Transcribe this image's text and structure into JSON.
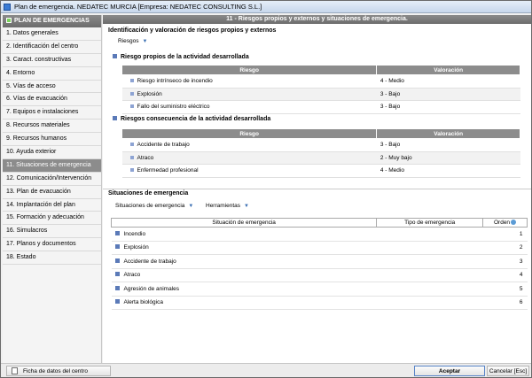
{
  "window": {
    "title": "Plan de emergencia. NEDATEC MURCIA  [Empresa: NEDATEC CONSULTING S.L.]"
  },
  "sidebar": {
    "header": "PLAN DE EMERGENCIAS",
    "items": [
      {
        "label": "1. Datos generales"
      },
      {
        "label": "2. Identificación del centro"
      },
      {
        "label": "3. Caract. constructivas"
      },
      {
        "label": "4. Entorno"
      },
      {
        "label": "5. Vías de acceso"
      },
      {
        "label": "6. Vías de evacuación"
      },
      {
        "label": "7. Equipos e instalaciones"
      },
      {
        "label": "8. Recursos materiales"
      },
      {
        "label": "9. Recursos humanos"
      },
      {
        "label": "10. Ayuda exterior"
      },
      {
        "label": "11. Situaciones de emergencia"
      },
      {
        "label": "12. Comunicación/Intervención"
      },
      {
        "label": "13. Plan de evacuación"
      },
      {
        "label": "14. Implantación del plan"
      },
      {
        "label": "15. Formación y adecuación"
      },
      {
        "label": "16. Simulacros"
      },
      {
        "label": "17. Planos y documentos"
      },
      {
        "label": "18. Estado"
      }
    ],
    "active_index": 10
  },
  "main": {
    "header": "11 - Riesgos propios y externos y situaciones de emergencia.",
    "section1_title": "Identificación y valoración de riesgos propios y externos",
    "riesgos_menu": "Riesgos",
    "propios": {
      "title": "Riesgo propios de la actividad desarrollada",
      "col_riesgo": "Riesgo",
      "col_valoracion": "Valoración",
      "rows": [
        {
          "riesgo": "Riesgo intrínseco de incendio",
          "valoracion": "4 - Medio"
        },
        {
          "riesgo": "Explosión",
          "valoracion": "3 - Bajo"
        },
        {
          "riesgo": "Fallo del suministro eléctrico",
          "valoracion": "3 - Bajo"
        }
      ]
    },
    "consecuencia": {
      "title": "Riesgos consecuencia de la actividad desarrollada",
      "col_riesgo": "Riesgo",
      "col_valoracion": "Valoración",
      "rows": [
        {
          "riesgo": "Accidente de trabajo",
          "valoracion": "3 - Bajo"
        },
        {
          "riesgo": "Atraco",
          "valoracion": "2 - Muy bajo"
        },
        {
          "riesgo": "Enfermedad profesional",
          "valoracion": "4 - Medio"
        }
      ]
    },
    "section2_title": "Situaciones de emergencia",
    "situaciones_menu": "Situaciones de emergencia",
    "herramientas_menu": "Herramientas",
    "emergencias": {
      "col_situacion": "Situación de emergencia",
      "col_tipo": "Tipo de emergencia",
      "col_orden": "Orden",
      "rows": [
        {
          "situacion": "Incendio",
          "tipo": "",
          "orden": "1"
        },
        {
          "situacion": "Explosión",
          "tipo": "",
          "orden": "2"
        },
        {
          "situacion": "Accidente de trabajo",
          "tipo": "",
          "orden": "3"
        },
        {
          "situacion": "Atraco",
          "tipo": "",
          "orden": "4"
        },
        {
          "situacion": "Agresión de animales",
          "tipo": "",
          "orden": "5"
        },
        {
          "situacion": "Alerta biológica",
          "tipo": "",
          "orden": "6"
        }
      ]
    }
  },
  "footer": {
    "ficha_label": "Ficha de datos del centro",
    "aceptar_label": "Aceptar",
    "cancelar_label": "Cancelar [Esc]"
  }
}
